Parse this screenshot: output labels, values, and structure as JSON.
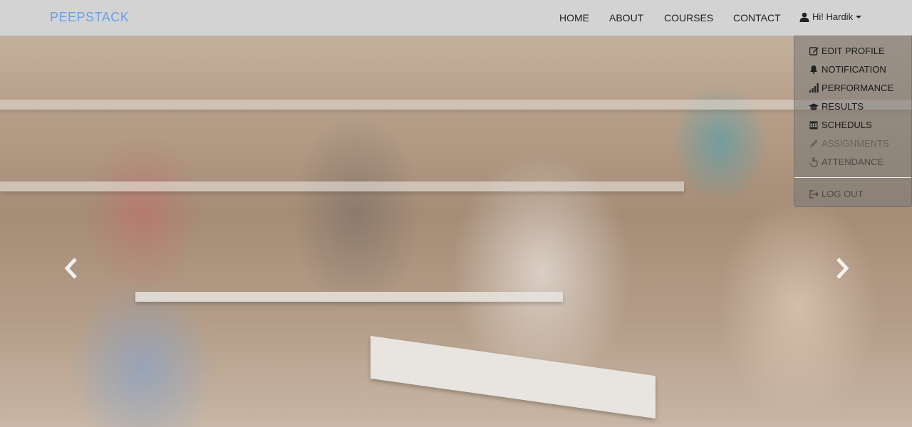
{
  "brand": "PEEPSTACK",
  "nav": {
    "home": "HOME",
    "about": "ABOUT",
    "courses": "COURSES",
    "contact": "CONTACT"
  },
  "user": {
    "greeting": "Hi! Hardik",
    "icon": "user-icon"
  },
  "dropdown": {
    "items": [
      {
        "label": "EDIT PROFILE",
        "icon": "edit-icon"
      },
      {
        "label": "NOTIFICATION",
        "icon": "bell-icon"
      },
      {
        "label": "PERFORMANCE",
        "icon": "signal-icon"
      },
      {
        "label": "RESULTS",
        "icon": "graduation-cap-icon"
      },
      {
        "label": "SCHEDULS",
        "icon": "calendar-icon"
      },
      {
        "label": "ASSIGNMENTS",
        "icon": "pencil-icon"
      },
      {
        "label": "ATTENDANCE",
        "icon": "hand-icon"
      }
    ],
    "logout": {
      "label": "LOG OUT",
      "icon": "logout-icon"
    }
  },
  "carousel": {
    "prev_icon": "chevron-left-icon",
    "next_icon": "chevron-right-icon"
  },
  "colors": {
    "navbar_bg": "#d3d3d3",
    "brand": "#6b9fe8",
    "dropdown_bg": "rgba(120,120,120,0.55)"
  }
}
